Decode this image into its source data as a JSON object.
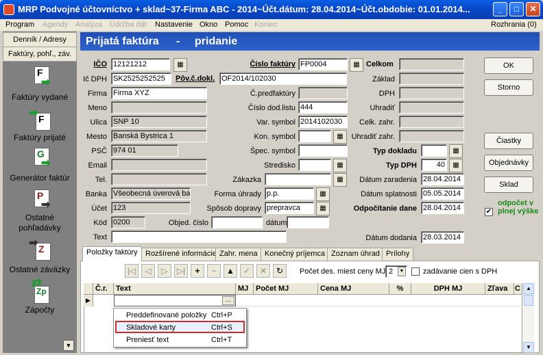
{
  "window": {
    "title": "MRP Podvojné účtovníctvo + sklad~37-Firma ABC - 2014~Účt.dátum: 28.04.2014~Účt.obdobie: 01.01.2014..."
  },
  "menu": {
    "items": [
      {
        "label": "Program",
        "disabled": false
      },
      {
        "label": "Agendy",
        "disabled": true
      },
      {
        "label": "Analýza",
        "disabled": true
      },
      {
        "label": "Údržba dát",
        "disabled": true
      },
      {
        "label": "Nastavenie",
        "disabled": false
      },
      {
        "label": "Okno",
        "disabled": false
      },
      {
        "label": "Pomoc",
        "disabled": false
      },
      {
        "label": "Koniec",
        "disabled": true
      }
    ],
    "right": "Rozhrania (0)"
  },
  "sidebar": {
    "tabs": [
      "Denník / Adresy",
      "Faktúry, pohľ., záv."
    ],
    "items": [
      {
        "label": "Faktúry vydané",
        "icon": "invoice-out-icon"
      },
      {
        "label": "Faktúry prijaté",
        "icon": "invoice-in-icon"
      },
      {
        "label": "Generátor faktúr",
        "icon": "generator-icon"
      },
      {
        "label": "Ostatné pohľadávky",
        "icon": "receivables-icon"
      },
      {
        "label": "Ostatné záväzky",
        "icon": "liabilities-icon"
      },
      {
        "label": "Zápočty",
        "icon": "offsets-icon"
      }
    ]
  },
  "header": {
    "title": "Prijatá faktúra",
    "sep": "-",
    "mode": "pridanie"
  },
  "form": {
    "ico_label": "IČO",
    "ico": "12121212",
    "icdph_label": "Ič DPH",
    "icdph": "SK2525252525",
    "firma_label": "Firma",
    "firma": "Firma XYZ",
    "meno_label": "Meno",
    "meno": "",
    "ulica_label": "Ulica",
    "ulica": "SNP 10",
    "mesto_label": "Mesto",
    "mesto": "Banská Bystrica 1",
    "psc_label": "PSČ",
    "psc": "974 01",
    "email_label": "Email",
    "email": "",
    "tel_label": "Tel.",
    "tel": "",
    "banka_label": "Banka",
    "banka": "Všeobecná úverová ba",
    "ucet_label": "Účet",
    "ucet": "123",
    "kod_label": "Kód",
    "kod": "0200",
    "text_label": "Text",
    "text": "",
    "cislo_fakt_label": "Číslo faktúry",
    "cislo_fakt": "FP0004",
    "pov_c_dokl_label": "Pôv.č.dokl.",
    "pov_c_dokl": "OF2014/102030",
    "c_predfakt_label": "Č.predfaktúry",
    "c_predfakt": "",
    "c_dod_listu_label": "Číslo dod.listu",
    "c_dod_listu": "444",
    "var_symbol_label": "Var. symbol",
    "var_symbol": "2014102030",
    "kon_symbol_label": "Kon. symbol",
    "kon_symbol": "",
    "spec_symbol_label": "Špec. symbol",
    "spec_symbol": "",
    "stredisko_label": "Stredisko",
    "stredisko": "",
    "zakazka_label": "Zákazka",
    "zakazka": "",
    "forma_uhrady_label": "Forma úhrady",
    "forma_uhrady": "p.p.",
    "sposob_dopravy_label": "Spôsob dopravy",
    "sposob_dopravy": "prepravca",
    "obj_cislo_label": "Objed. číslo",
    "obj_cislo": "",
    "datum_label": "dátum",
    "datum": "",
    "celkom_label": "Celkom",
    "zaklad_label": "Základ",
    "dph_label": "DPH",
    "uhradit_label": "Uhradiť",
    "celk_zahr_label": "Celk. zahr.",
    "uhradit_zahr_label": "Uhradiť zahr.",
    "typ_dokladu_label": "Typ dokladu",
    "typ_dokladu": "",
    "typ_dph_label": "Typ DPH",
    "typ_dph": "40",
    "datum_zaradenia_label": "Dátum zaradenia",
    "datum_zaradenia": "28.04.2014",
    "datum_splatnosti_label": "Dátum splatnosti",
    "datum_splatnosti": "05.05.2014",
    "odpoc_dane_label": "Odpočítanie dane",
    "odpoc_dane": "28.04.2014",
    "datum_dodania_label": "Dátum dodania",
    "datum_dodania": "28.03.2014"
  },
  "buttons": {
    "ok": "OK",
    "storno": "Storno",
    "ciastky": "Čiastky",
    "objednavky": "Objednávky",
    "sklad": "Sklad"
  },
  "odpocet": {
    "checked": true,
    "label": "odpočet v plnej výške"
  },
  "tabs": [
    "Položky faktúry",
    "Rozšírené informácie",
    "Zahr. mena",
    "Konečný príjemca",
    "Zoznam úhrad",
    "Prílohy"
  ],
  "grid_toolbar": {
    "pocet_label": "Počet des. miest ceny MJ",
    "pocet_value": "2",
    "zadavanie_label": "zadávanie cien s DPH"
  },
  "grid": {
    "columns": [
      "Č.r.",
      "Text",
      "MJ",
      "Počet MJ",
      "Cena MJ",
      "%",
      "DPH MJ",
      "Zľava",
      "C"
    ],
    "ellipsis": "..."
  },
  "context_menu": [
    {
      "label": "Preddefinované položky",
      "shortcut": "Ctrl+P",
      "highlighted": false
    },
    {
      "label": "Skladové karty",
      "shortcut": "Ctrl+S",
      "highlighted": true
    },
    {
      "label": "Preniesť text",
      "shortcut": "Ctrl+T",
      "highlighted": false
    }
  ]
}
